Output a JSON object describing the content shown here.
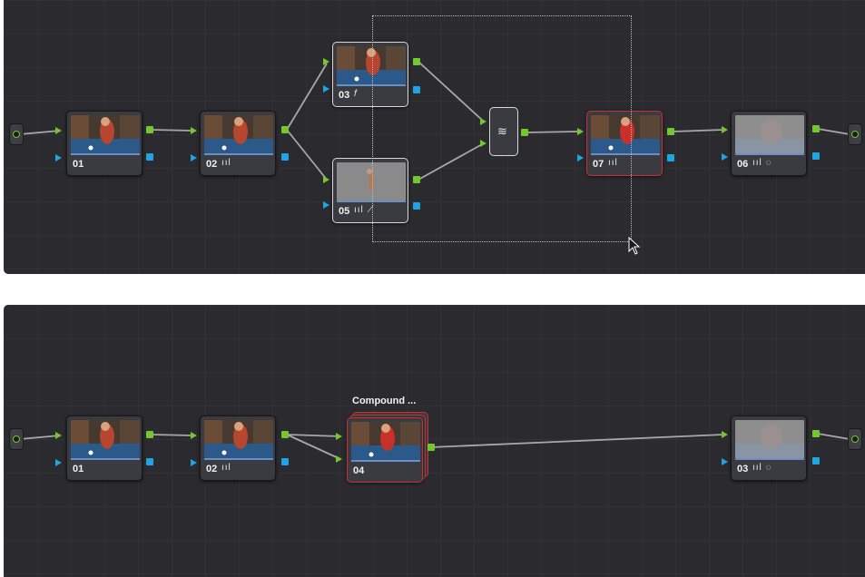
{
  "colors": {
    "panel_bg": "#2b2b2f",
    "rgb_port": "#74c72d",
    "key_port": "#1fa6e0",
    "active_border": "#c83232",
    "selected_border": "#d9d9d9"
  },
  "top_graph": {
    "nodes": [
      {
        "label": "01",
        "icons": ""
      },
      {
        "label": "02",
        "icons": "ııl"
      },
      {
        "label": "03",
        "icons": "𝑓"
      },
      {
        "label": "05",
        "icons": "ııl ⟋"
      },
      {
        "label": "07",
        "icons": "ııl"
      },
      {
        "label": "06",
        "icons": "ııl ◌"
      }
    ],
    "layer_mixer_icon": "layers-icon"
  },
  "bottom_graph": {
    "compound_title": "Compound ...",
    "nodes": [
      {
        "label": "01",
        "icons": ""
      },
      {
        "label": "02",
        "icons": "ııl"
      },
      {
        "label": "04",
        "icons": ""
      },
      {
        "label": "03",
        "icons": "ııl ◌"
      }
    ]
  }
}
